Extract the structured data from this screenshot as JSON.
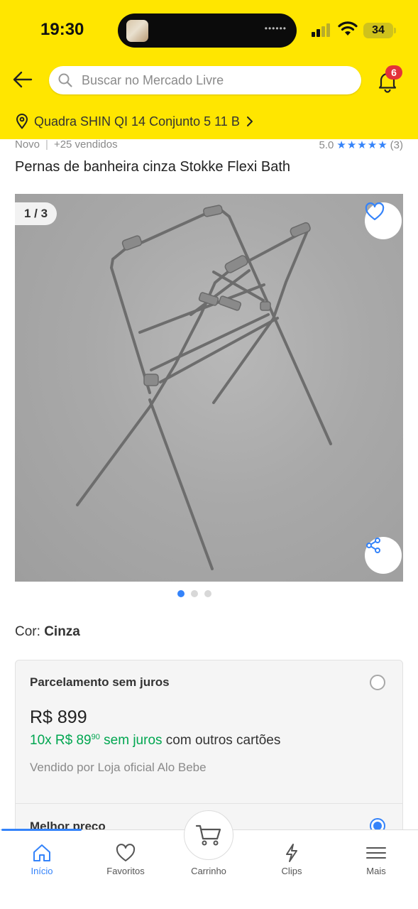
{
  "status_bar": {
    "time": "19:30",
    "battery": "34"
  },
  "header": {
    "search_placeholder": "Buscar no Mercado Livre",
    "notifications_count": "6",
    "location": "Quadra SHIN QI 14 Conjunto 5 11 B"
  },
  "product": {
    "condition": "Novo",
    "sold": "+25 vendidos",
    "rating": "5.0",
    "rating_stars": "★★★★★",
    "reviews_count": "(3)",
    "title": "Pernas de banheira cinza Stokke Flexi Bath",
    "gallery_counter": "1 / 3",
    "color_label": "Cor:",
    "color_value": "Cinza"
  },
  "payment": {
    "option1_title": "Parcelamento sem juros",
    "price": "R$ 899",
    "installments_prefix": "10x R$ 89",
    "installments_cents": "90",
    "installments_green_suffix": "sem juros",
    "installments_suffix": "com outros cartões",
    "seller": "Vendido por Loja oficial Alo Bebe",
    "option2_title": "Melhor preço"
  },
  "bottom_nav": {
    "items": [
      {
        "label": "Início",
        "icon": "home-icon"
      },
      {
        "label": "Favoritos",
        "icon": "heart-icon"
      },
      {
        "label": "Carrinho",
        "icon": "cart-icon"
      },
      {
        "label": "Clips",
        "icon": "lightning-icon"
      },
      {
        "label": "Mais",
        "icon": "menu-icon"
      }
    ]
  },
  "colors": {
    "brand_yellow": "#ffe600",
    "accent_blue": "#3483fa",
    "green": "#00a650",
    "badge_red": "#e3323a"
  }
}
